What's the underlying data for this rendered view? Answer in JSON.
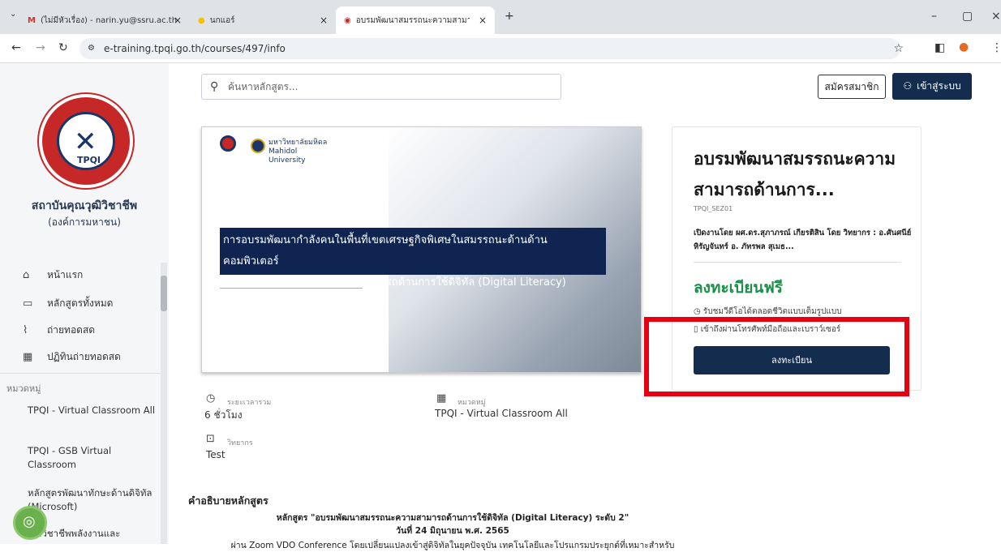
{
  "browser": {
    "tabs": [
      {
        "label": "(ไม่มีหัวเรื่อง) - narin.yu@ssru.ac.th"
      },
      {
        "label": "นกแอร์"
      },
      {
        "label": "อบรมพัฒนาสมรรถนะความสามารถด้..."
      }
    ],
    "new_tab": "+",
    "url": "e-training.tpqi.go.th/courses/497/info"
  },
  "sidebar": {
    "org_name": "สถาบันคุณวุฒิวิชาชีพ",
    "org_sub": "(องค์การมหาชน)",
    "nav": [
      {
        "label": "หน้าแรก",
        "icon": "home-icon"
      },
      {
        "label": "หลักสูตรทั้งหมด",
        "icon": "monitor-icon"
      },
      {
        "label": "ถ่ายทอดสด",
        "icon": "rss-icon"
      },
      {
        "label": "ปฏิทินถ่ายทอดสด",
        "icon": "calendar-icon"
      }
    ],
    "category_label": "หมวดหมู่",
    "categories": [
      {
        "label": "TPQI - Virtual Classroom All"
      },
      {
        "label": "TPQI - GSB Virtual Classroom"
      },
      {
        "label": "หลักสูตรพัฒนาทักษะด้านดิจิทัล (Microsoft)"
      },
      {
        "label": "...าวิชาชีพพลังงานและ"
      }
    ]
  },
  "header": {
    "search_placeholder": "ค้นหาหลักสูตร...",
    "register_label": "สมัครสมาชิก",
    "login_label": "เข้าสู่ระบบ"
  },
  "banner": {
    "university": "มหาวิทยาลัยมหิดล Mahidol University",
    "title_line1": "การอบรมพัฒนากำลังคนในพื้นที่เขตเศรษฐกิจพิเศษในสมรรถนะด้านด้านคอมพิวเตอร์",
    "title_line2": "และสารสนเทศสมรรถนะความสามารถด้านการใช้ดิจิทัล (Digital Literacy)"
  },
  "meta": {
    "duration_label": "ระยะเวลารวม",
    "duration_value": "6 ชั่วโมง",
    "category_label": "หมวดหมู่",
    "category_value": "TPQI - Virtual Classroom All",
    "speaker_label": "วิทยากร",
    "speaker_value": "Test"
  },
  "card": {
    "title": "อบรมพัฒนาสมรรถนะความสามารถด้านการ...",
    "code": "TPQI_SEZ01",
    "by": "เปิดงานโดย ผศ.ดร.สุภาภรณ์ เกียรติสิน โดย วิทยากร : อ.ศันศนีย์ หิรัญจันทร์ อ. ภัทรพล สุเมธ...",
    "price": "ลงทะเบียนฟรี",
    "feature1": "รับชมวีดีโอได้ตลอดชีวิตแบบเต็มรูปแบบ",
    "feature2": "เข้าถึงผ่านโทรศัพท์มือถือและเบราว์เซอร์",
    "enroll_label": "ลงทะเบียน"
  },
  "description": {
    "heading": "คำอธิบายหลักสูตร",
    "line1": "หลักสูตร \"อบรมพัฒนาสมรรถนะความสามารถด้านการใช้ดิจิทัล (Digital Literacy) ระดับ 2\"",
    "line2": "วันที่ 24 มิถุนายน พ.ศ. 2565",
    "line3": "ผ่าน Zoom VDO Conference โดยเปลี่ยนแปลงเข้าสู่ดิจิทัลในยุคปัจจุบัน เทคโนโลยีและโปรแกรมประยุกต์ที่เหมาะสำหรับ"
  },
  "colors": {
    "brand": "#142c4d",
    "free": "#1b8f4a",
    "highlight": "#e60012"
  }
}
